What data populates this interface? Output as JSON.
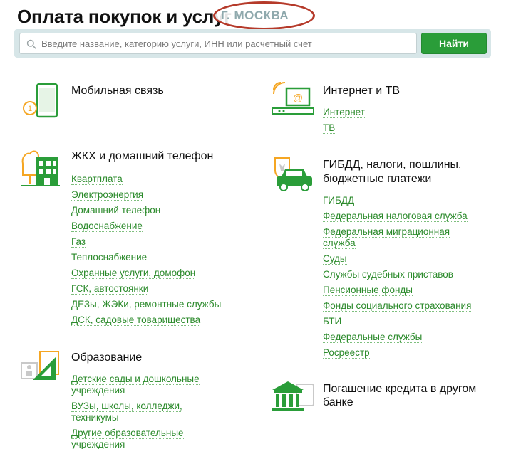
{
  "header": {
    "title": "Оплата покупок и услуг",
    "city": "Г. МОСКВА"
  },
  "search": {
    "placeholder": "Введите название, категорию услуги, ИНН или расчетный счет",
    "value": "",
    "button_label": "Найти"
  },
  "colors": {
    "accent_green": "#2a9d39",
    "link_green": "#2b8a2b",
    "icon_orange": "#f5a623",
    "oval_red": "#b53a2a"
  },
  "categories": {
    "mobile": {
      "icon": "mobile-phone-icon",
      "title": "Мобильная связь",
      "links": []
    },
    "internet_tv": {
      "icon": "internet-tv-icon",
      "title": "Интернет и ТВ",
      "links": [
        "Интернет",
        "ТВ"
      ]
    },
    "housing": {
      "icon": "house-icon",
      "title": "ЖКХ и домашний телефон",
      "links": [
        "Квартплата",
        "Электроэнергия",
        "Домашний телефон",
        "Водоснабжение",
        "Газ",
        "Теплоснабжение",
        "Охранные услуги, домофон",
        "ГСК, автостоянки",
        "ДЕЗы, ЖЭКи, ремонтные службы",
        "ДСК, садовые товарищества"
      ]
    },
    "gibdd": {
      "icon": "car-emblem-icon",
      "title_line1": "ГИБДД, налоги, пошлины,",
      "title_line2": "бюджетные платежи",
      "links": [
        "ГИБДД",
        "Федеральная налоговая служба",
        "Федеральная миграционная",
        "служба",
        "Суды",
        "Службы судебных приставов",
        "Пенсионные фонды",
        "Фонды социального страхования",
        "БТИ",
        "Федеральные службы",
        "Росреестр"
      ]
    },
    "education": {
      "icon": "education-icon",
      "title": "Образование",
      "links": [
        "Детские сады и дошкольные",
        "учреждения",
        "ВУЗы, школы, колледжи,",
        "техникумы",
        "Другие образовательные",
        "учреждения"
      ]
    },
    "credit": {
      "icon": "bank-icon",
      "title_line1": "Погашение кредита в другом",
      "title_line2": "банке"
    }
  }
}
